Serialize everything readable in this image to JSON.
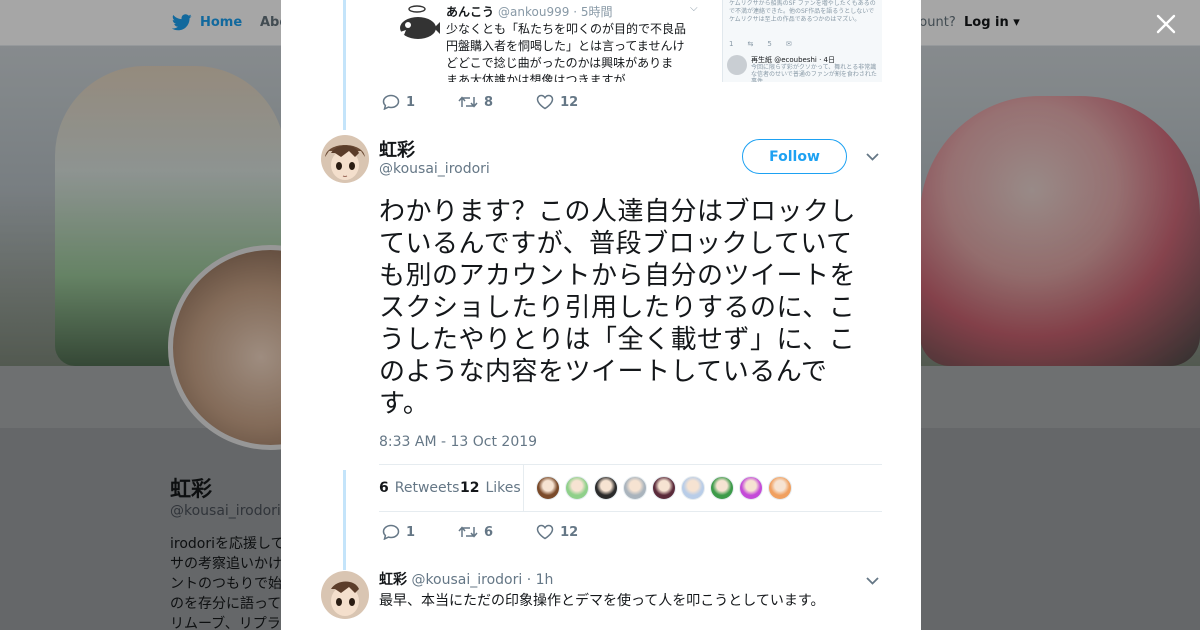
{
  "nav": {
    "home_label": "Home",
    "about_label": "Abo",
    "account_prompt": "ccount?",
    "login_label": "Log in"
  },
  "profile": {
    "name": "虹彩",
    "handle": "@kousai_irodori",
    "bio_lines": [
      "irodoriを応援して",
      "サの考察追いかけ",
      "ントのつもりで始",
      "のを存分に語って",
      "リムーブ、リプラ"
    ]
  },
  "quoted_tweet": {
    "name": "あんこう",
    "handle": "@ankou999",
    "time": "· 5時間",
    "text_lines": [
      "少なくとも「私たちを叩くのが目的で不良品",
      "円盤購入者を恫喝した」とは言ってませんけ",
      "どどこで捻じ曲がったのかは興味がありま",
      "まあ大体誰かは想像はつきますが"
    ],
    "side_text": "ケムリクサから船馬のSF ファンを増やしたくもあるので不満が連絡できた。他のSF作品を語るうとしないでケムリクサは至上の作品であるつかのはマズい。",
    "side_stats": [
      "1",
      "",
      "5",
      ""
    ],
    "side_name": "再生紙 @ecoubeshi · 4日",
    "side_subtext": "今回に限らず彩がクソかって、舞れとる非常識な信者のせいで普通のファンが割を食わされた事件"
  },
  "prev_actions": {
    "replies": "1",
    "retweets": "8",
    "likes": "12"
  },
  "tweet": {
    "name": "虹彩",
    "handle": "@kousai_irodori",
    "follow_label": "Follow",
    "text": "わかります？この人達自分はブロックしているんですが、普段ブロックしていても別のアカウントから自分のツイートをスクショしたり引用したりするのに、こうしたやりとりは「全く載せず」に、このような内容をツイートしているんです。",
    "timestamp": "8:33 AM - 13 Oct 2019",
    "retweets_count": "6",
    "retweets_label": "Retweets",
    "likes_count": "12",
    "likes_label": "Likes",
    "liker_colors": [
      "#7a4a2a",
      "#8fd08a",
      "#2b2b2b",
      "#aab4bd",
      "#5b2b3b",
      "#b9cde8",
      "#3d9b4a",
      "#c44bd8",
      "#f0a060"
    ],
    "actions": {
      "replies": "1",
      "retweets": "6",
      "likes": "12"
    }
  },
  "reply": {
    "name": "虹彩",
    "handle": "@kousai_irodori",
    "time": "· 1h",
    "text": "最早、本当にただの印象操作とデマを使って人を叩こうとしています。"
  },
  "colors": {
    "twitter_blue": "#1da1f2",
    "thread_line": "#c4e4fa",
    "text_primary": "#14171a",
    "text_secondary": "#657786"
  }
}
